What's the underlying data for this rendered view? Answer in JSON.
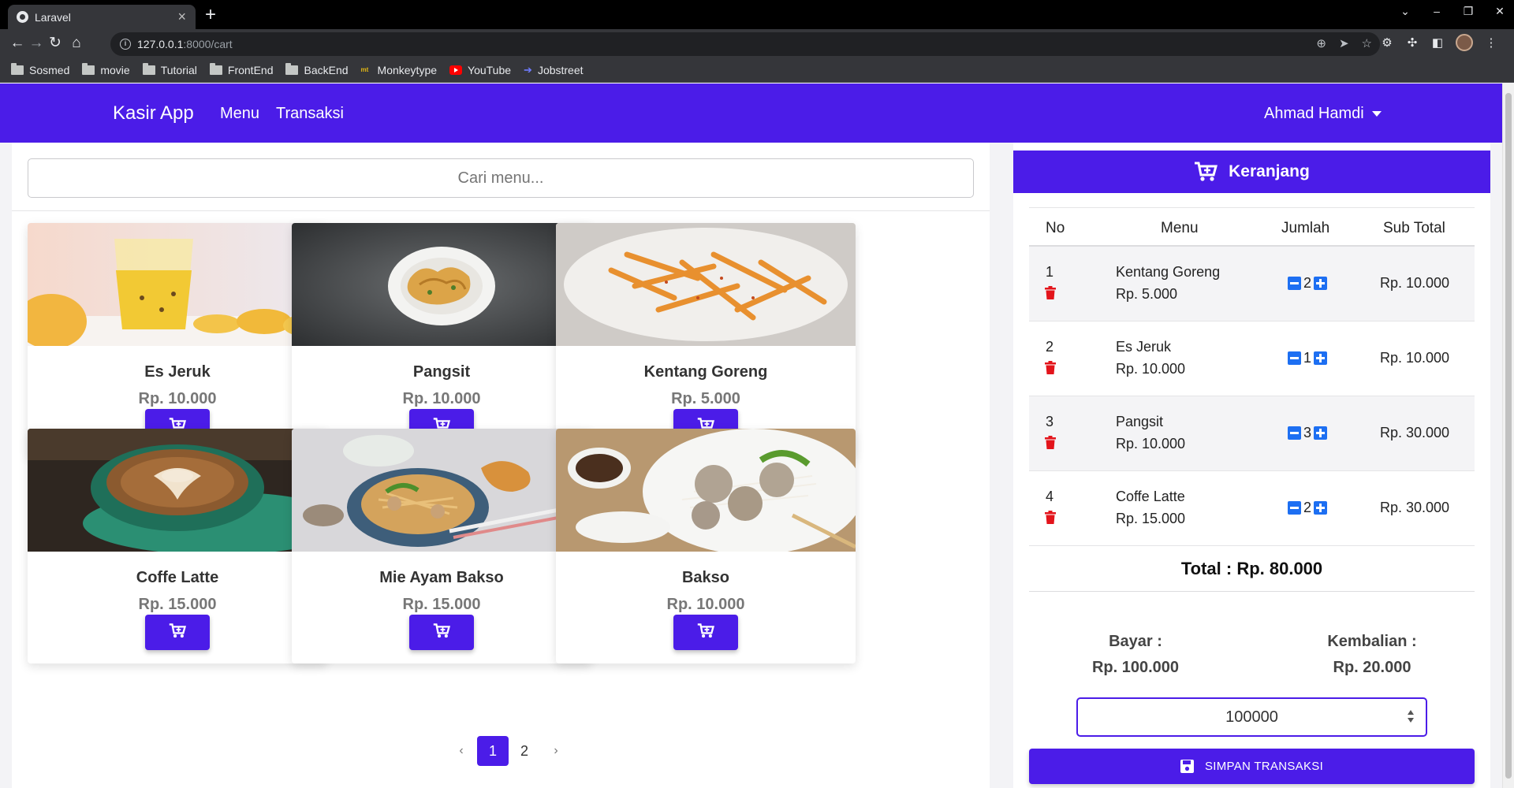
{
  "browser": {
    "tab_title": "Laravel",
    "url_host": "127.0.0.1",
    "url_path": ":8000/cart",
    "bookmarks": [
      {
        "label": "Sosmed",
        "icon": "folder-icon"
      },
      {
        "label": "movie",
        "icon": "folder-icon"
      },
      {
        "label": "Tutorial",
        "icon": "folder-icon"
      },
      {
        "label": "FrontEnd",
        "icon": "folder-icon"
      },
      {
        "label": "BackEnd",
        "icon": "folder-icon"
      },
      {
        "label": "Monkeytype",
        "icon": "monkeytype-icon"
      },
      {
        "label": "YouTube",
        "icon": "youtube-icon"
      },
      {
        "label": "Jobstreet",
        "icon": "jobstreet-icon"
      }
    ]
  },
  "navbar": {
    "brand": "Kasir App",
    "links": [
      "Menu",
      "Transaksi"
    ],
    "user": "Ahmad Hamdi",
    "color": "#4b1ce8"
  },
  "search": {
    "placeholder": "Cari menu..."
  },
  "products": [
    {
      "name": "Es Jeruk",
      "price": "Rp. 10.000",
      "image": "orange-juice"
    },
    {
      "name": "Pangsit",
      "price": "Rp. 10.000",
      "image": "fried-wonton"
    },
    {
      "name": "Kentang Goreng",
      "price": "Rp. 5.000",
      "image": "french-fries"
    },
    {
      "name": "Coffe Latte",
      "price": "Rp. 15.000",
      "image": "latte"
    },
    {
      "name": "Mie Ayam Bakso",
      "price": "Rp. 15.000",
      "image": "chicken-noodle"
    },
    {
      "name": "Bakso",
      "price": "Rp. 10.000",
      "image": "meatball-soup"
    }
  ],
  "pagination": {
    "prev": "‹",
    "pages": [
      "1",
      "2"
    ],
    "next": "›",
    "current": "1"
  },
  "cart": {
    "title": "Keranjang",
    "headers": [
      "No",
      "Menu",
      "Jumlah",
      "Sub Total"
    ],
    "items": [
      {
        "no": "1",
        "menu": "Kentang Goreng",
        "price": "Rp. 5.000",
        "qty": "2",
        "subtotal": "Rp. 10.000"
      },
      {
        "no": "2",
        "menu": "Es Jeruk",
        "price": "Rp. 10.000",
        "qty": "1",
        "subtotal": "Rp. 10.000"
      },
      {
        "no": "3",
        "menu": "Pangsit",
        "price": "Rp. 10.000",
        "qty": "3",
        "subtotal": "Rp. 30.000"
      },
      {
        "no": "4",
        "menu": "Coffe Latte",
        "price": "Rp. 15.000",
        "qty": "2",
        "subtotal": "Rp. 30.000"
      }
    ],
    "total": "Total : Rp. 80.000",
    "bayar_label": "Bayar :",
    "bayar_value": "Rp. 100.000",
    "kembalian_label": "Kembalian :",
    "kembalian_value": "Rp. 20.000",
    "payment_input": "100000",
    "save_label": "SIMPAN TRANSAKSI"
  }
}
